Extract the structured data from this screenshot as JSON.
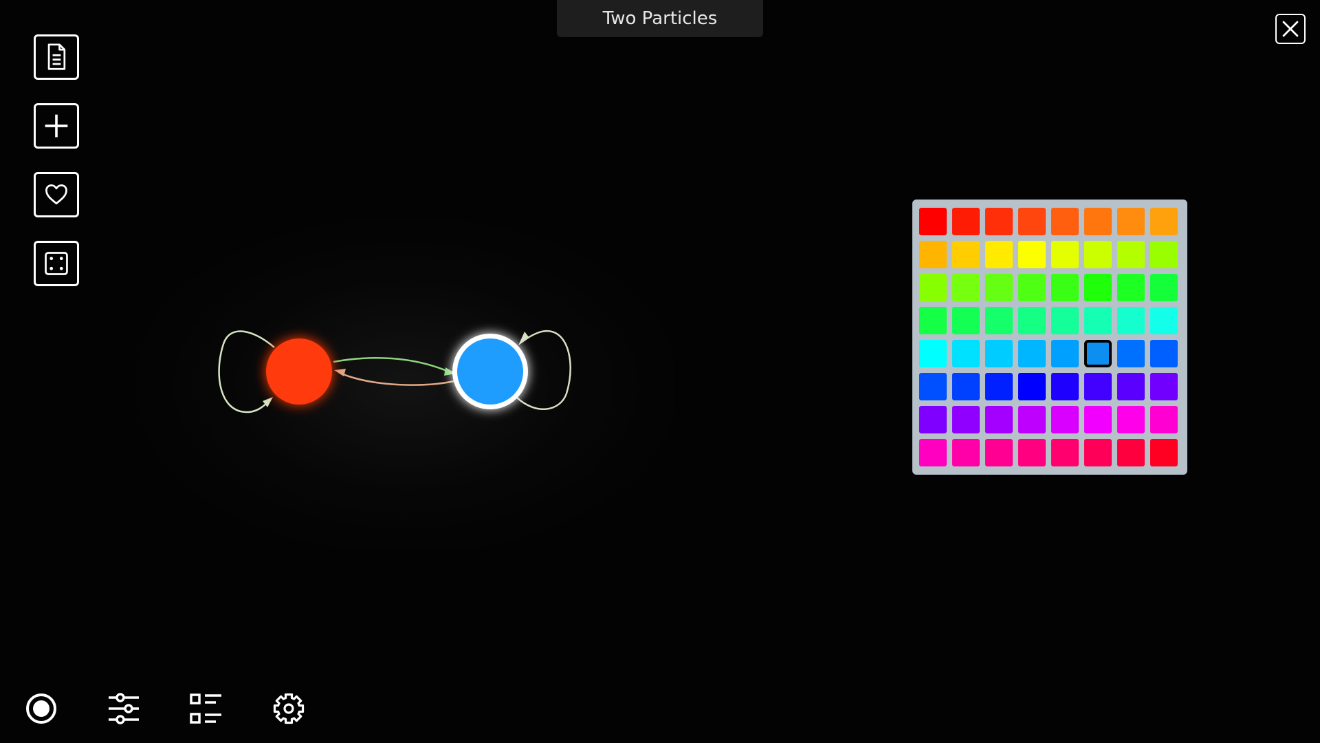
{
  "window": {
    "title": "Two Particles"
  },
  "toolbar_left": [
    {
      "name": "document-button",
      "icon": "document-icon"
    },
    {
      "name": "add-button",
      "icon": "plus-icon"
    },
    {
      "name": "favorite-button",
      "icon": "heart-icon"
    },
    {
      "name": "randomize-button",
      "icon": "dice-icon"
    }
  ],
  "toolbar_bottom": [
    {
      "name": "record-button",
      "icon": "record-icon"
    },
    {
      "name": "sliders-button",
      "icon": "sliders-icon"
    },
    {
      "name": "list-button",
      "icon": "list-icon"
    },
    {
      "name": "settings-button",
      "icon": "gear-icon"
    }
  ],
  "close_icon": "close-icon",
  "particles": [
    {
      "name": "red-particle",
      "color": "#ff3a0a",
      "glow": "#ff3a0a",
      "selected": false
    },
    {
      "name": "blue-particle",
      "color": "#1f9dff",
      "glow": "#1f9dff",
      "selected": true
    }
  ],
  "arrows": [
    {
      "name": "red-self-loop-arrow",
      "color": "#d6e6c2"
    },
    {
      "name": "red-to-blue-arrow",
      "color": "#8fd47f"
    },
    {
      "name": "blue-to-red-arrow",
      "color": "#e0a888"
    },
    {
      "name": "blue-self-loop-arrow",
      "color": "#d6e0c4"
    }
  ],
  "palette": {
    "selected_index": 37,
    "colors": [
      "#ff0000",
      "#ff1c05",
      "#ff2f0a",
      "#ff460f",
      "#ff5f0f",
      "#ff760f",
      "#ff8c0f",
      "#ffa10d",
      "#ffb500",
      "#ffcd00",
      "#ffea00",
      "#fbff00",
      "#e4ff00",
      "#cbff00",
      "#b3ff00",
      "#99ff00",
      "#88ff00",
      "#77ff10",
      "#66ff14",
      "#4fff14",
      "#38ff14",
      "#1fff0a",
      "#1eff22",
      "#14ff3a",
      "#14ff46",
      "#14ff54",
      "#14ff6a",
      "#14ff84",
      "#14ff99",
      "#14ffb4",
      "#14ffcd",
      "#14ffea",
      "#00ffff",
      "#00e1ff",
      "#00ccff",
      "#00b6ff",
      "#00a0ff",
      "#0d8ff2",
      "#0070ff",
      "#0060ff",
      "#0050ff",
      "#0040ff",
      "#0020ff",
      "#0000ff",
      "#1e00ff",
      "#4200ff",
      "#5a00ff",
      "#7100ff",
      "#8000ff",
      "#9000ff",
      "#a400ff",
      "#be00ff",
      "#d900ff",
      "#f200ff",
      "#ff00ea",
      "#ff00d2",
      "#ff00c0",
      "#ff00a8",
      "#ff0092",
      "#ff0080",
      "#ff006e",
      "#ff0058",
      "#ff003e",
      "#ff0022"
    ]
  }
}
